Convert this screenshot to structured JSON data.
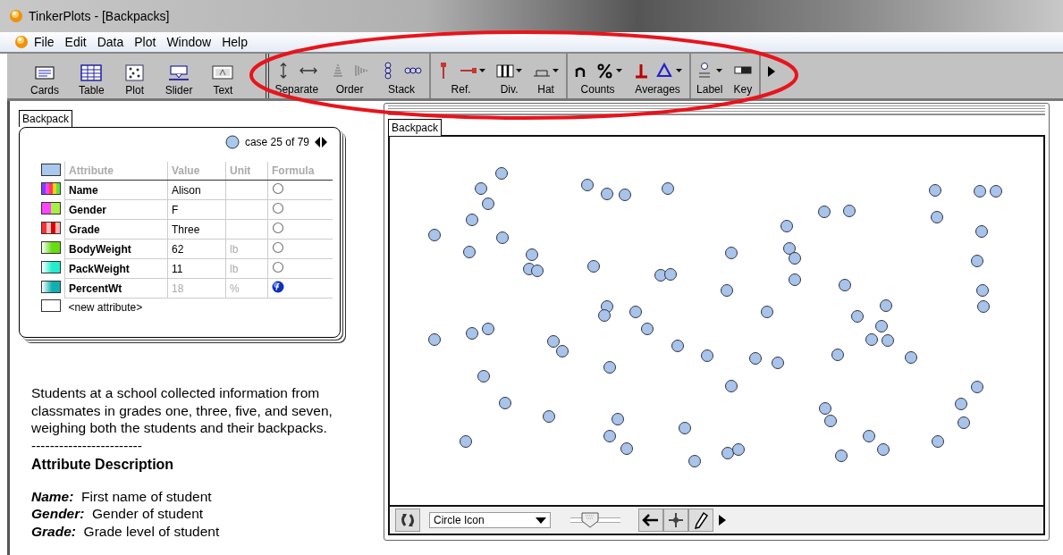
{
  "window": {
    "title": "TinkerPlots - [Backpacks]"
  },
  "menu": [
    "File",
    "Edit",
    "Data",
    "Plot",
    "Window",
    "Help"
  ],
  "object_tools": [
    {
      "label": "Cards",
      "kind": "cards"
    },
    {
      "label": "Table",
      "kind": "table"
    },
    {
      "label": "Plot",
      "kind": "plot"
    },
    {
      "label": "Slider",
      "kind": "slider"
    },
    {
      "label": "Text",
      "kind": "text"
    }
  ],
  "plot_tool_sections": [
    [
      {
        "label": "Separate",
        "icons": [
          {
            "kind": "vsep"
          },
          {
            "kind": "hsep"
          }
        ]
      },
      {
        "label": "Order",
        "icons": [
          {
            "kind": "order-v"
          },
          {
            "kind": "order-h"
          }
        ]
      },
      {
        "label": "Stack",
        "icons": [
          {
            "kind": "stack-v"
          },
          {
            "kind": "stack-h"
          }
        ]
      }
    ],
    [
      {
        "label": "Ref.",
        "icons": [
          {
            "kind": "ref-v"
          },
          {
            "kind": "ref-h",
            "menu": true
          }
        ]
      },
      {
        "label": "Div.",
        "icons": [
          {
            "kind": "div",
            "menu": true
          }
        ]
      },
      {
        "label": "Hat",
        "icons": [
          {
            "kind": "hat",
            "menu": true
          }
        ]
      }
    ],
    [
      {
        "label": "Counts",
        "icons": [
          {
            "kind": "count-n"
          },
          {
            "kind": "percent",
            "menu": true
          }
        ]
      },
      {
        "label": "Averages",
        "icons": [
          {
            "kind": "mean"
          },
          {
            "kind": "median",
            "menu": true
          }
        ]
      }
    ],
    [
      {
        "label": "Label",
        "icons": [
          {
            "kind": "label",
            "menu": true
          }
        ]
      },
      {
        "label": "Key",
        "icons": [
          {
            "kind": "key"
          }
        ]
      }
    ]
  ],
  "card": {
    "tab": "Backpack",
    "case_label": "case 25 of 79",
    "columns": [
      "Attribute",
      "Value",
      "Unit",
      "Formula"
    ],
    "rows": [
      {
        "name": "Name",
        "value": "Alison",
        "unit": "",
        "has_formula": false,
        "kind": "categorical",
        "swatch": [
          {
            "color": "#8040ff"
          },
          {
            "color": "#ff40ff"
          },
          {
            "color": "#ff4040"
          },
          {
            "color": "#ffd020"
          },
          {
            "color": "#60e040"
          }
        ]
      },
      {
        "name": "Gender",
        "value": "F",
        "unit": "",
        "has_formula": false,
        "kind": "categorical",
        "swatch": [
          {
            "color": "#ff44ff"
          },
          {
            "color": "#aaee44"
          }
        ]
      },
      {
        "name": "Grade",
        "value": "Three",
        "unit": "",
        "has_formula": false,
        "kind": "categorical",
        "swatch": [
          {
            "color": "#ff3030"
          },
          {
            "color": "#ffc0c0"
          },
          {
            "color": "#e00000"
          },
          {
            "color": "#ffb0b0"
          }
        ]
      },
      {
        "name": "BodyWeight",
        "value": "62",
        "unit": "lb",
        "has_formula": false,
        "kind": "numeric",
        "swatch": [
          {
            "color": "#66dd11"
          }
        ]
      },
      {
        "name": "PackWeight",
        "value": "11",
        "unit": "lb",
        "has_formula": false,
        "kind": "numeric",
        "swatch": [
          {
            "color": "#22eecc"
          }
        ]
      },
      {
        "name": "PercentWt",
        "value": "18",
        "unit": "%",
        "has_formula": true,
        "kind": "numeric",
        "swatch": [
          {
            "color": "#11b0b0"
          }
        ]
      }
    ],
    "new_attribute": "<new attribute>"
  },
  "text": {
    "paragraph": "Students at a school collected information from classmates in grades one, three, five, and seven, weighing both the students and their backpacks.",
    "rule": "------------------------",
    "heading": "Attribute Description",
    "definitions": [
      {
        "term": "Name:",
        "text": "First name of student"
      },
      {
        "term": "Gender:",
        "text": "Gender of student"
      },
      {
        "term": "Grade:",
        "text": "Grade level of student"
      }
    ]
  },
  "plot": {
    "tab": "Backpack",
    "icon_menu": "Circle Icon",
    "icon_size": {
      "level": 0.4
    }
  }
}
